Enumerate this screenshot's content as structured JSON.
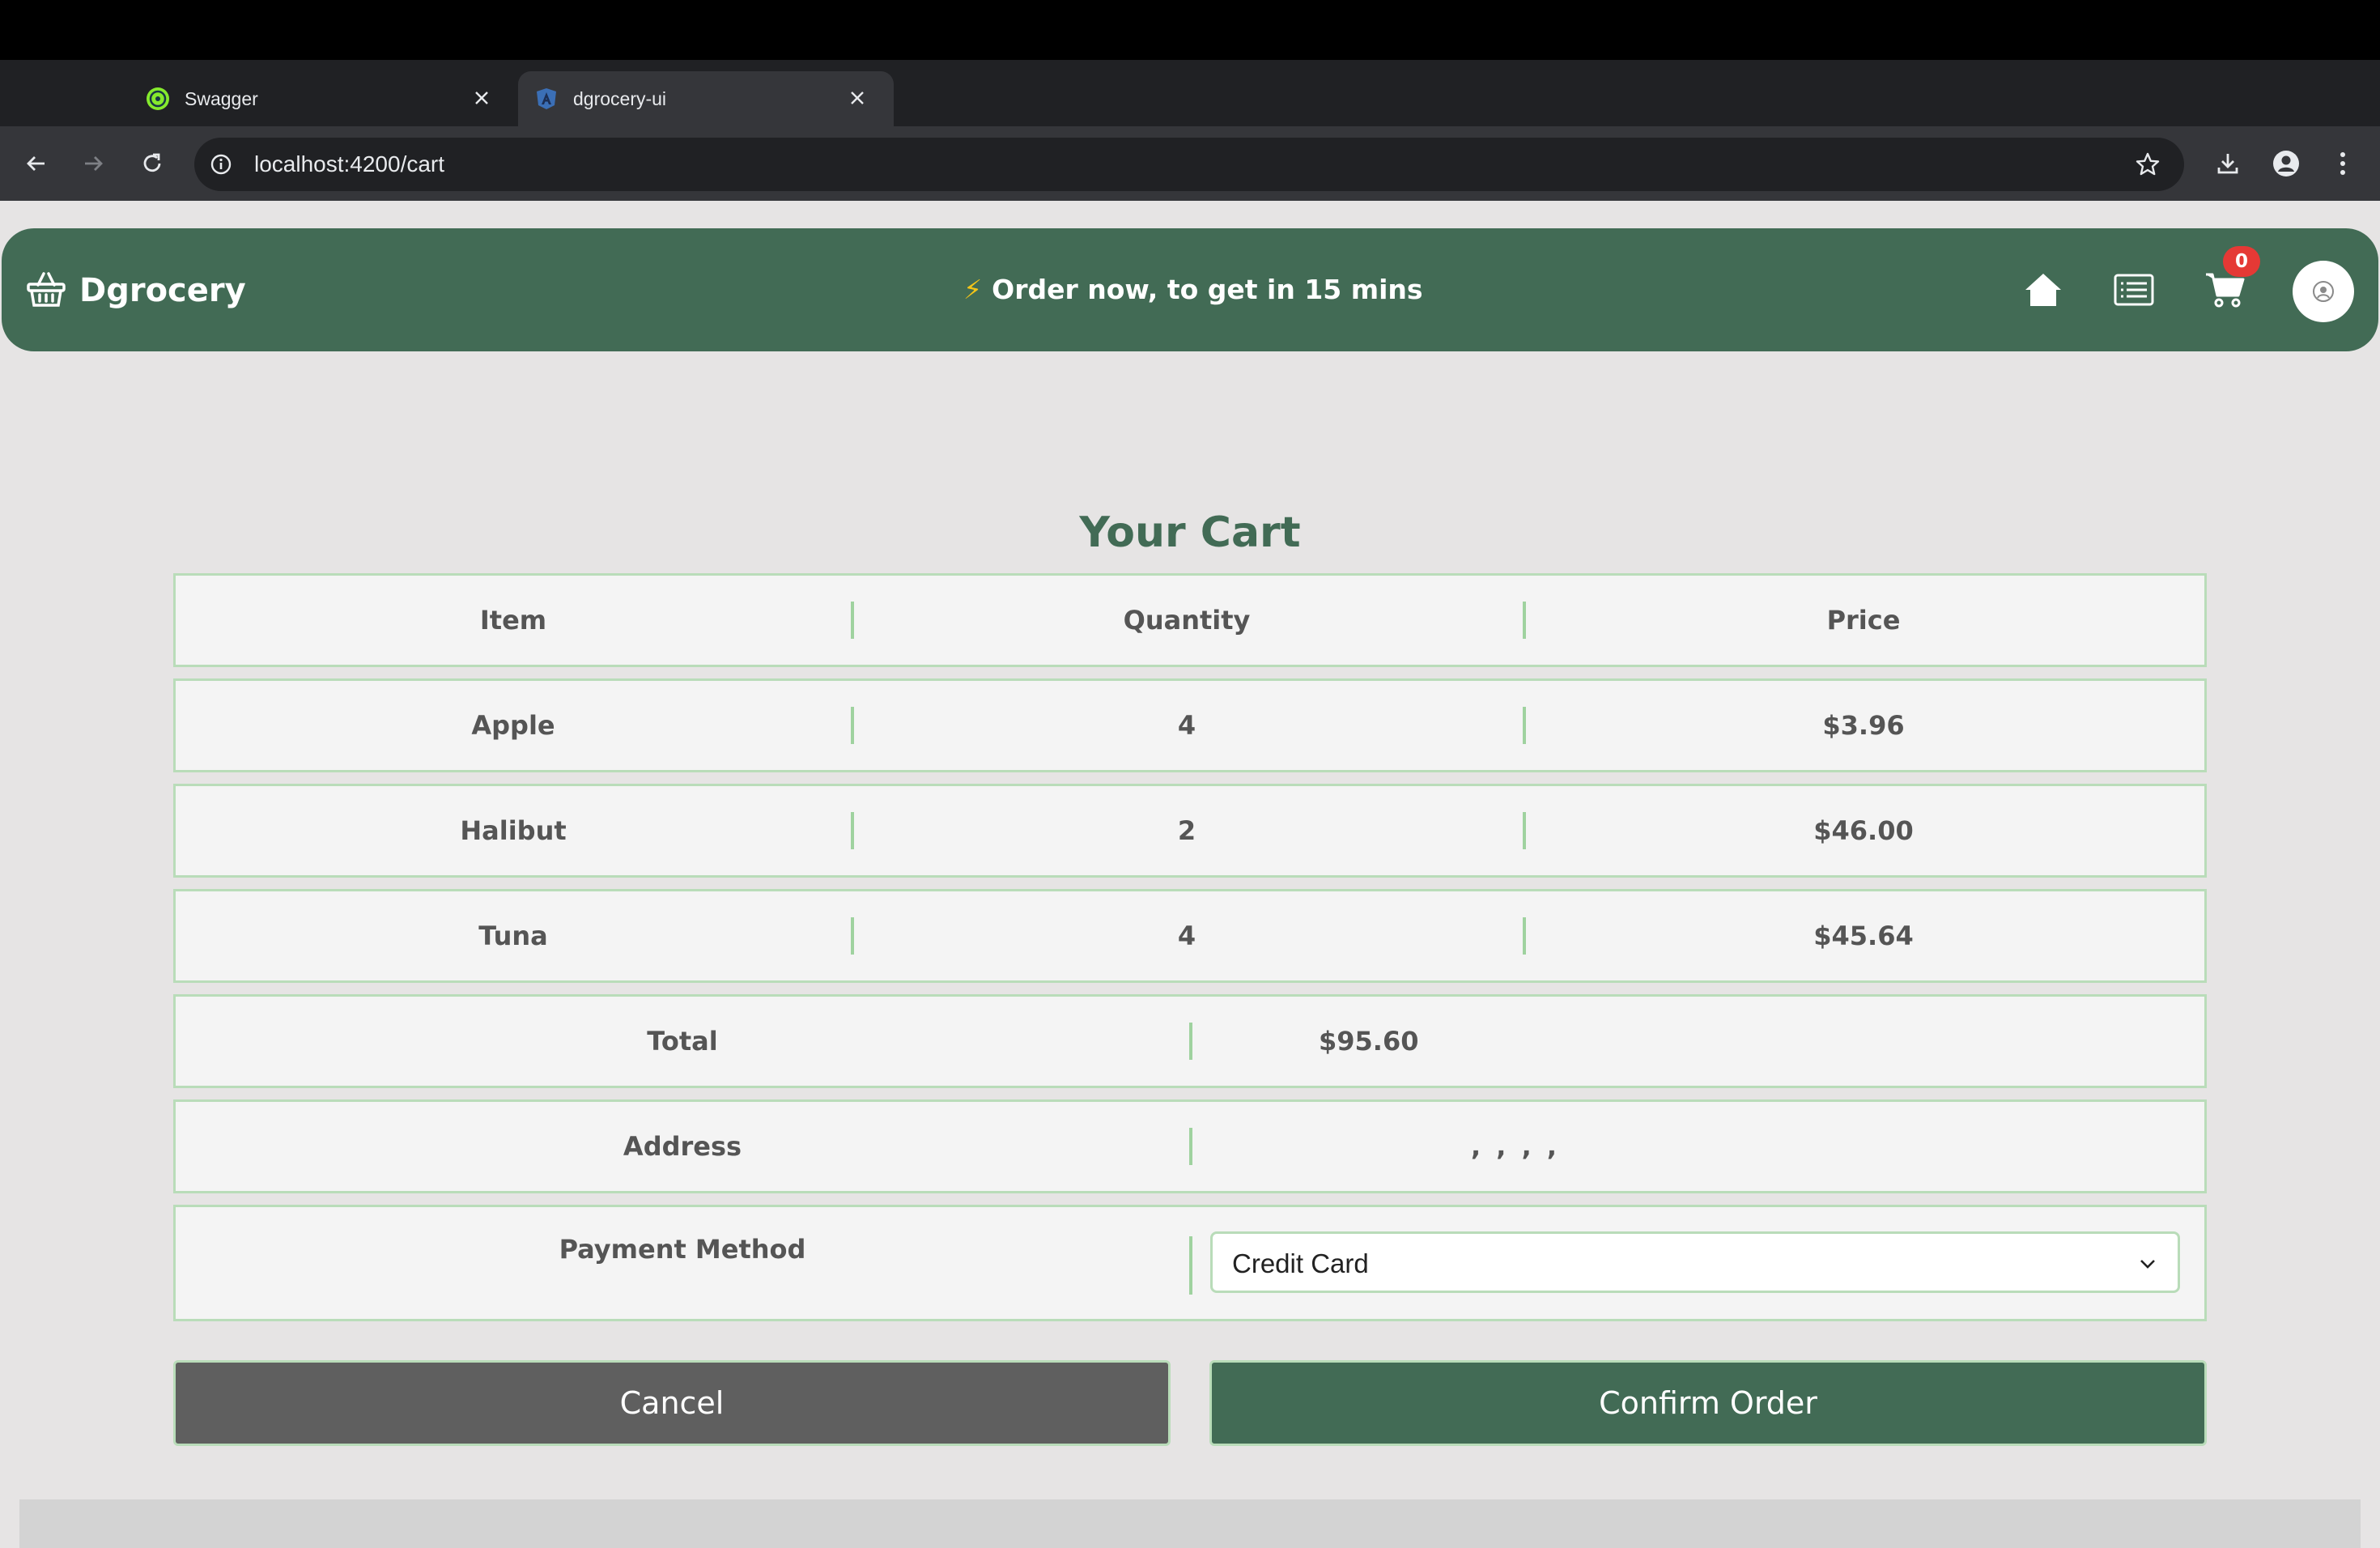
{
  "browser": {
    "tabs": [
      {
        "title": "Swagger",
        "active": false
      },
      {
        "title": "dgrocery-ui",
        "active": true
      }
    ],
    "url": "localhost:4200/cart"
  },
  "header": {
    "brand": "Dgrocery",
    "promo": "Order now, to get in 15 mins",
    "promo_icon": "lightning-icon",
    "cart_count": "0",
    "icons": [
      "home-icon",
      "list-icon",
      "cart-icon",
      "avatar"
    ]
  },
  "cart": {
    "title": "Your Cart",
    "columns": [
      "Item",
      "Quantity",
      "Price"
    ],
    "items": [
      {
        "item": "Apple",
        "quantity": "4",
        "price": "$3.96"
      },
      {
        "item": "Halibut",
        "quantity": "2",
        "price": "$46.00"
      },
      {
        "item": "Tuna",
        "quantity": "4",
        "price": "$45.64"
      }
    ],
    "total_label": "Total",
    "total_value": "$95.60",
    "address_label": "Address",
    "address_value": ", , , ,",
    "payment_label": "Payment Method",
    "payment_selected": "Credit Card"
  },
  "actions": {
    "cancel": "Cancel",
    "confirm": "Confirm Order"
  },
  "colors": {
    "brand_green": "#426b55",
    "border_green": "#b9dcb9",
    "badge_red": "#e53935",
    "cancel_gray": "#5f5f5f"
  }
}
